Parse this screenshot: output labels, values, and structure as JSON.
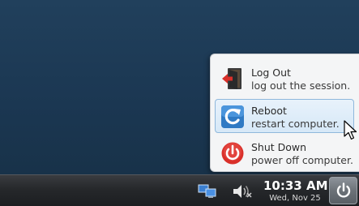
{
  "menu": {
    "items": [
      {
        "title": "Log Out",
        "subtitle": "log out the session.",
        "icon": "logout-icon"
      },
      {
        "title": "Reboot",
        "subtitle": "restart computer.",
        "icon": "reboot-icon",
        "highlighted": true
      },
      {
        "title": "Shut Down",
        "subtitle": "power off computer.",
        "icon": "shutdown-icon"
      }
    ]
  },
  "taskbar": {
    "tray": {
      "network_icon": "network-icon",
      "volume_icon": "volume-icon"
    },
    "clock": {
      "time": "10:33 AM",
      "date": "Wed, Nov 25"
    },
    "power_icon": "power-icon"
  },
  "colors": {
    "desktop": "#1d3a55",
    "menu_background": "#f4f5f6",
    "highlight": "#d6e8f7",
    "reboot_blue": "#2f7ac4",
    "shutdown_red": "#d9302a",
    "taskbar": "#26282b"
  }
}
